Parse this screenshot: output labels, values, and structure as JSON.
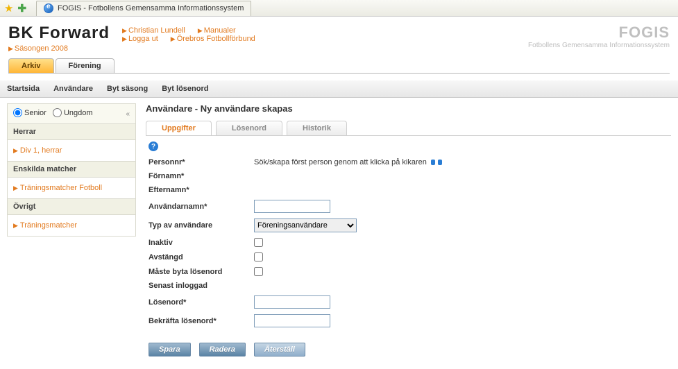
{
  "browser": {
    "tab_title": "FOGIS - Fotbollens Gemensamma Informationssystem"
  },
  "header": {
    "org_name": "BK Forward",
    "season_link": "Säsongen 2008",
    "links_row1": [
      "Christian Lundell",
      "Manualer"
    ],
    "links_row2": [
      "Logga ut",
      "Örebros Fotbollförbund"
    ],
    "brand": "FOGIS",
    "brand_sub": "Fotbollens Gemensamma Informationssystem"
  },
  "maintabs": {
    "active": "Arkiv",
    "other": "Förening"
  },
  "subnav": [
    "Startsida",
    "Användare",
    "Byt säsong",
    "Byt lösenord"
  ],
  "sidebar": {
    "radios": {
      "senior": "Senior",
      "ungdom": "Ungdom",
      "selected": "senior"
    },
    "sections": [
      {
        "title": "Herrar",
        "links": [
          "Div 1, herrar"
        ]
      },
      {
        "title": "Enskilda matcher",
        "links": [
          "Träningsmatcher Fotboll"
        ]
      },
      {
        "title": "Övrigt",
        "links": [
          "Träningsmatcher"
        ]
      }
    ]
  },
  "page": {
    "title": "Användare - Ny användare skapas",
    "subtabs": [
      "Uppgifter",
      "Lösenord",
      "Historik"
    ],
    "fields": {
      "personnr": "Personnr*",
      "personnr_hint": "Sök/skapa först person genom att klicka på kikaren",
      "fornamn": "Förnamn*",
      "efternamn": "Efternamn*",
      "anvandarnamn": "Användarnamn*",
      "typ": "Typ av användare",
      "typ_value": "Föreningsanvändare",
      "inaktiv": "Inaktiv",
      "avstangd": "Avstängd",
      "maste_byta": "Måste byta lösenord",
      "senast": "Senast inloggad",
      "losenord": "Lösenord*",
      "bekrafta": "Bekräfta lösenord*"
    },
    "buttons": {
      "spara": "Spara",
      "radera": "Radera",
      "aterstall": "Återställ"
    }
  }
}
